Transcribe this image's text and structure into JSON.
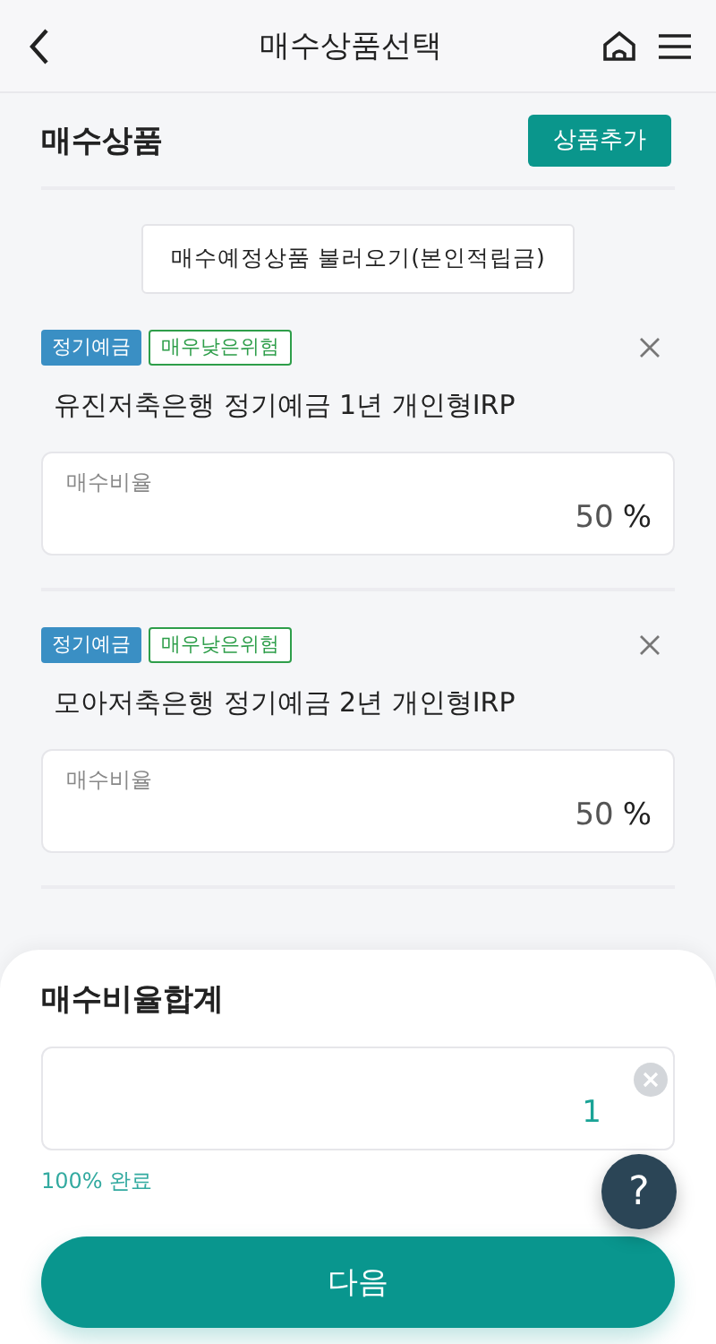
{
  "header": {
    "title": "매수상품선택"
  },
  "section": {
    "title": "매수상품",
    "add_button": "상품추가"
  },
  "load_button": "매수예정상품 불러오기(본인적립금)",
  "products": [
    {
      "tags": [
        {
          "label": "정기예금",
          "kind": "filled",
          "color": "#3a8fc4"
        },
        {
          "label": "매우낮은위험",
          "kind": "outline",
          "color": "#2e9e4a"
        }
      ],
      "name": "유진저축은행 정기예금 1년 개인형IRP",
      "field": {
        "label": "매수비율",
        "value": "50",
        "unit": "%"
      }
    },
    {
      "tags": [
        {
          "label": "정기예금",
          "kind": "filled",
          "color": "#3a8fc4"
        },
        {
          "label": "매우낮은위험",
          "kind": "outline",
          "color": "#2e9e4a"
        }
      ],
      "name": "모아저축은행 정기예금 2년 개인형IRP",
      "field": {
        "label": "매수비율",
        "value": "50",
        "unit": "%"
      }
    }
  ],
  "total": {
    "title": "매수비율합계",
    "value": "1",
    "status": "100% 완료"
  },
  "help_button": "?",
  "next_button": "다음"
}
